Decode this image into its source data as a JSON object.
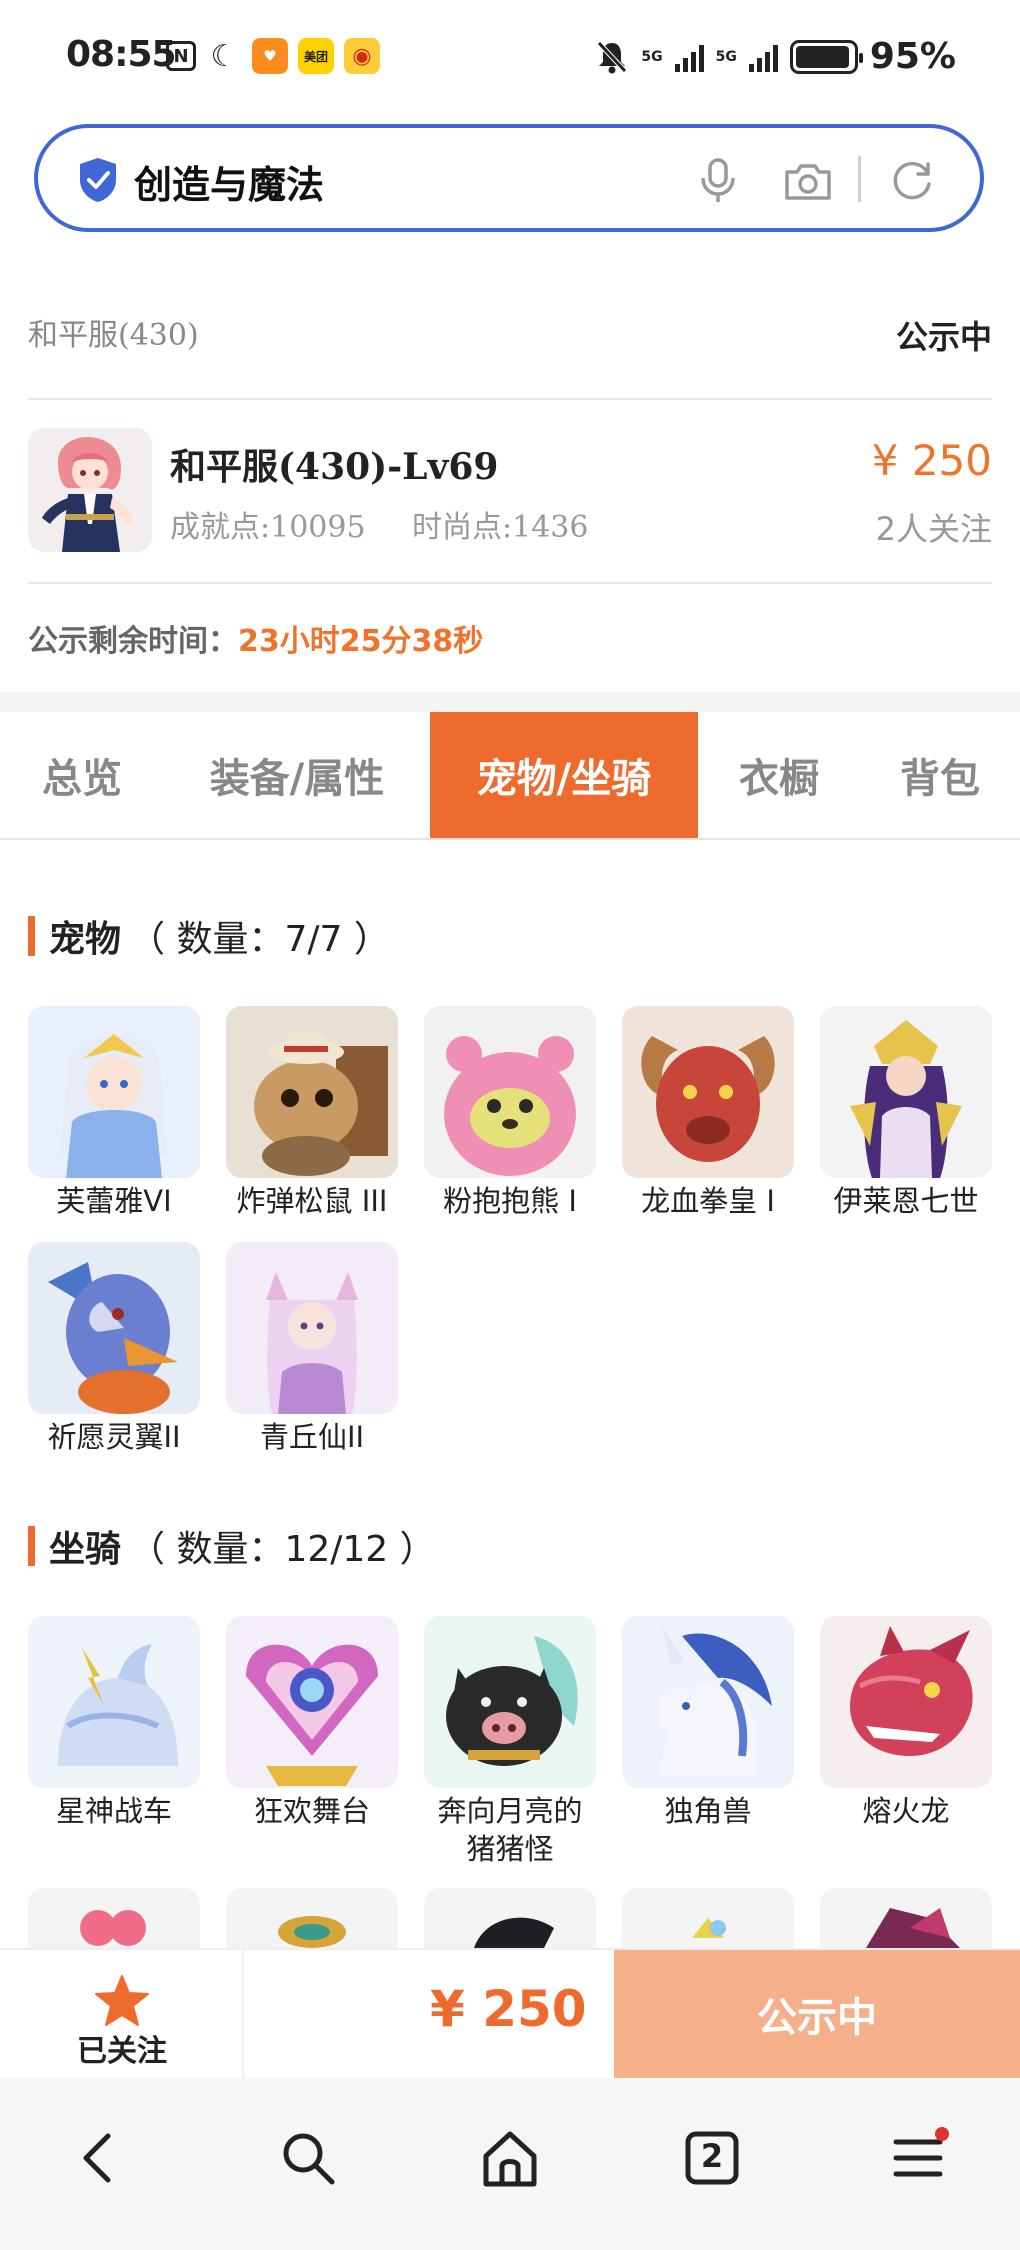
{
  "status_bar": {
    "time": "08:55",
    "signal_label_1": "5G",
    "signal_label_2": "5G",
    "battery_percent": "95%",
    "battery_level": 0.95,
    "meituan_label": "美团",
    "icons": [
      "nfc-icon",
      "moon-icon",
      "taobao-icon",
      "meituan-icon",
      "weibo-icon",
      "mute-icon",
      "signal-icon",
      "battery-icon"
    ]
  },
  "search": {
    "query": "创造与魔法",
    "accent_color": "#3f67d6"
  },
  "listing": {
    "server": "和平服(430)",
    "status": "公示中",
    "character_name": "和平服(430)-Lv69",
    "achievement": "成就点:10095",
    "fashion": "时尚点:1436",
    "price": "¥ 250",
    "followers": "2人关注",
    "countdown_label": "公示剩余时间：",
    "countdown_value": "23小时25分38秒",
    "accent_color": "#ef6b2d"
  },
  "tabs": [
    {
      "label": "总览"
    },
    {
      "label": "装备/属性"
    },
    {
      "label": "宠物/坐骑"
    },
    {
      "label": "衣橱"
    },
    {
      "label": "背包"
    }
  ],
  "active_tab": "宠物/坐骑",
  "pets": {
    "title": "宠物",
    "count": "（ 数量：7/7 ）",
    "items": [
      {
        "name": "芙蕾雅VI",
        "badge": "VI"
      },
      {
        "name": "炸弹松鼠 III",
        "badge": "III"
      },
      {
        "name": "粉抱抱熊 I",
        "badge": "I"
      },
      {
        "name": "龙血拳皇 I",
        "badge": "I"
      },
      {
        "name": "伊莱恩七世",
        "badge": ""
      },
      {
        "name": "祈愿灵翼II",
        "badge": "II"
      },
      {
        "name": "青丘仙II",
        "badge": "II"
      }
    ]
  },
  "mounts": {
    "title": "坐骑",
    "count": "（ 数量：12/12 ）",
    "items": [
      {
        "name": "星神战车"
      },
      {
        "name": "狂欢舞台"
      },
      {
        "name": "奔向月亮的猪猪怪"
      },
      {
        "name": "独角兽"
      },
      {
        "name": "熔火龙"
      }
    ]
  },
  "bottom_bar": {
    "follow_label": "已关注",
    "price": "¥ 250",
    "action_label": "公示中"
  },
  "nav": {
    "tab_count": "2",
    "icons": [
      "back-icon",
      "search-icon",
      "home-icon",
      "tabs-icon",
      "menu-icon"
    ]
  }
}
